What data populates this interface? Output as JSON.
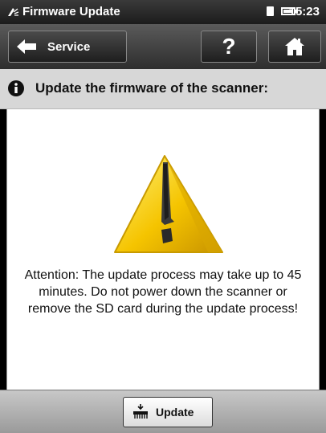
{
  "status_bar": {
    "title": "Firmware Update",
    "time": "15:23",
    "icons": [
      "app-icon",
      "sd-card-icon",
      "battery-icon"
    ]
  },
  "toolbar": {
    "back_label": "Service",
    "help_label": "?",
    "icons": [
      "back-arrow-icon",
      "home-icon"
    ]
  },
  "header": {
    "heading": "Update the firmware of the scanner:",
    "icon": "info-icon"
  },
  "content": {
    "icon": "warning-icon",
    "message": "Attention: The update process may take up to 45 minutes. Do not power down the scanner or remove the SD card during the update process!"
  },
  "footer": {
    "update_label": "Update",
    "icon": "firmware-update-icon"
  },
  "colors": {
    "warning_yellow": "#f5c400",
    "header_bg": "#d7d7d7",
    "bar_dark": "#2e2e2e"
  }
}
